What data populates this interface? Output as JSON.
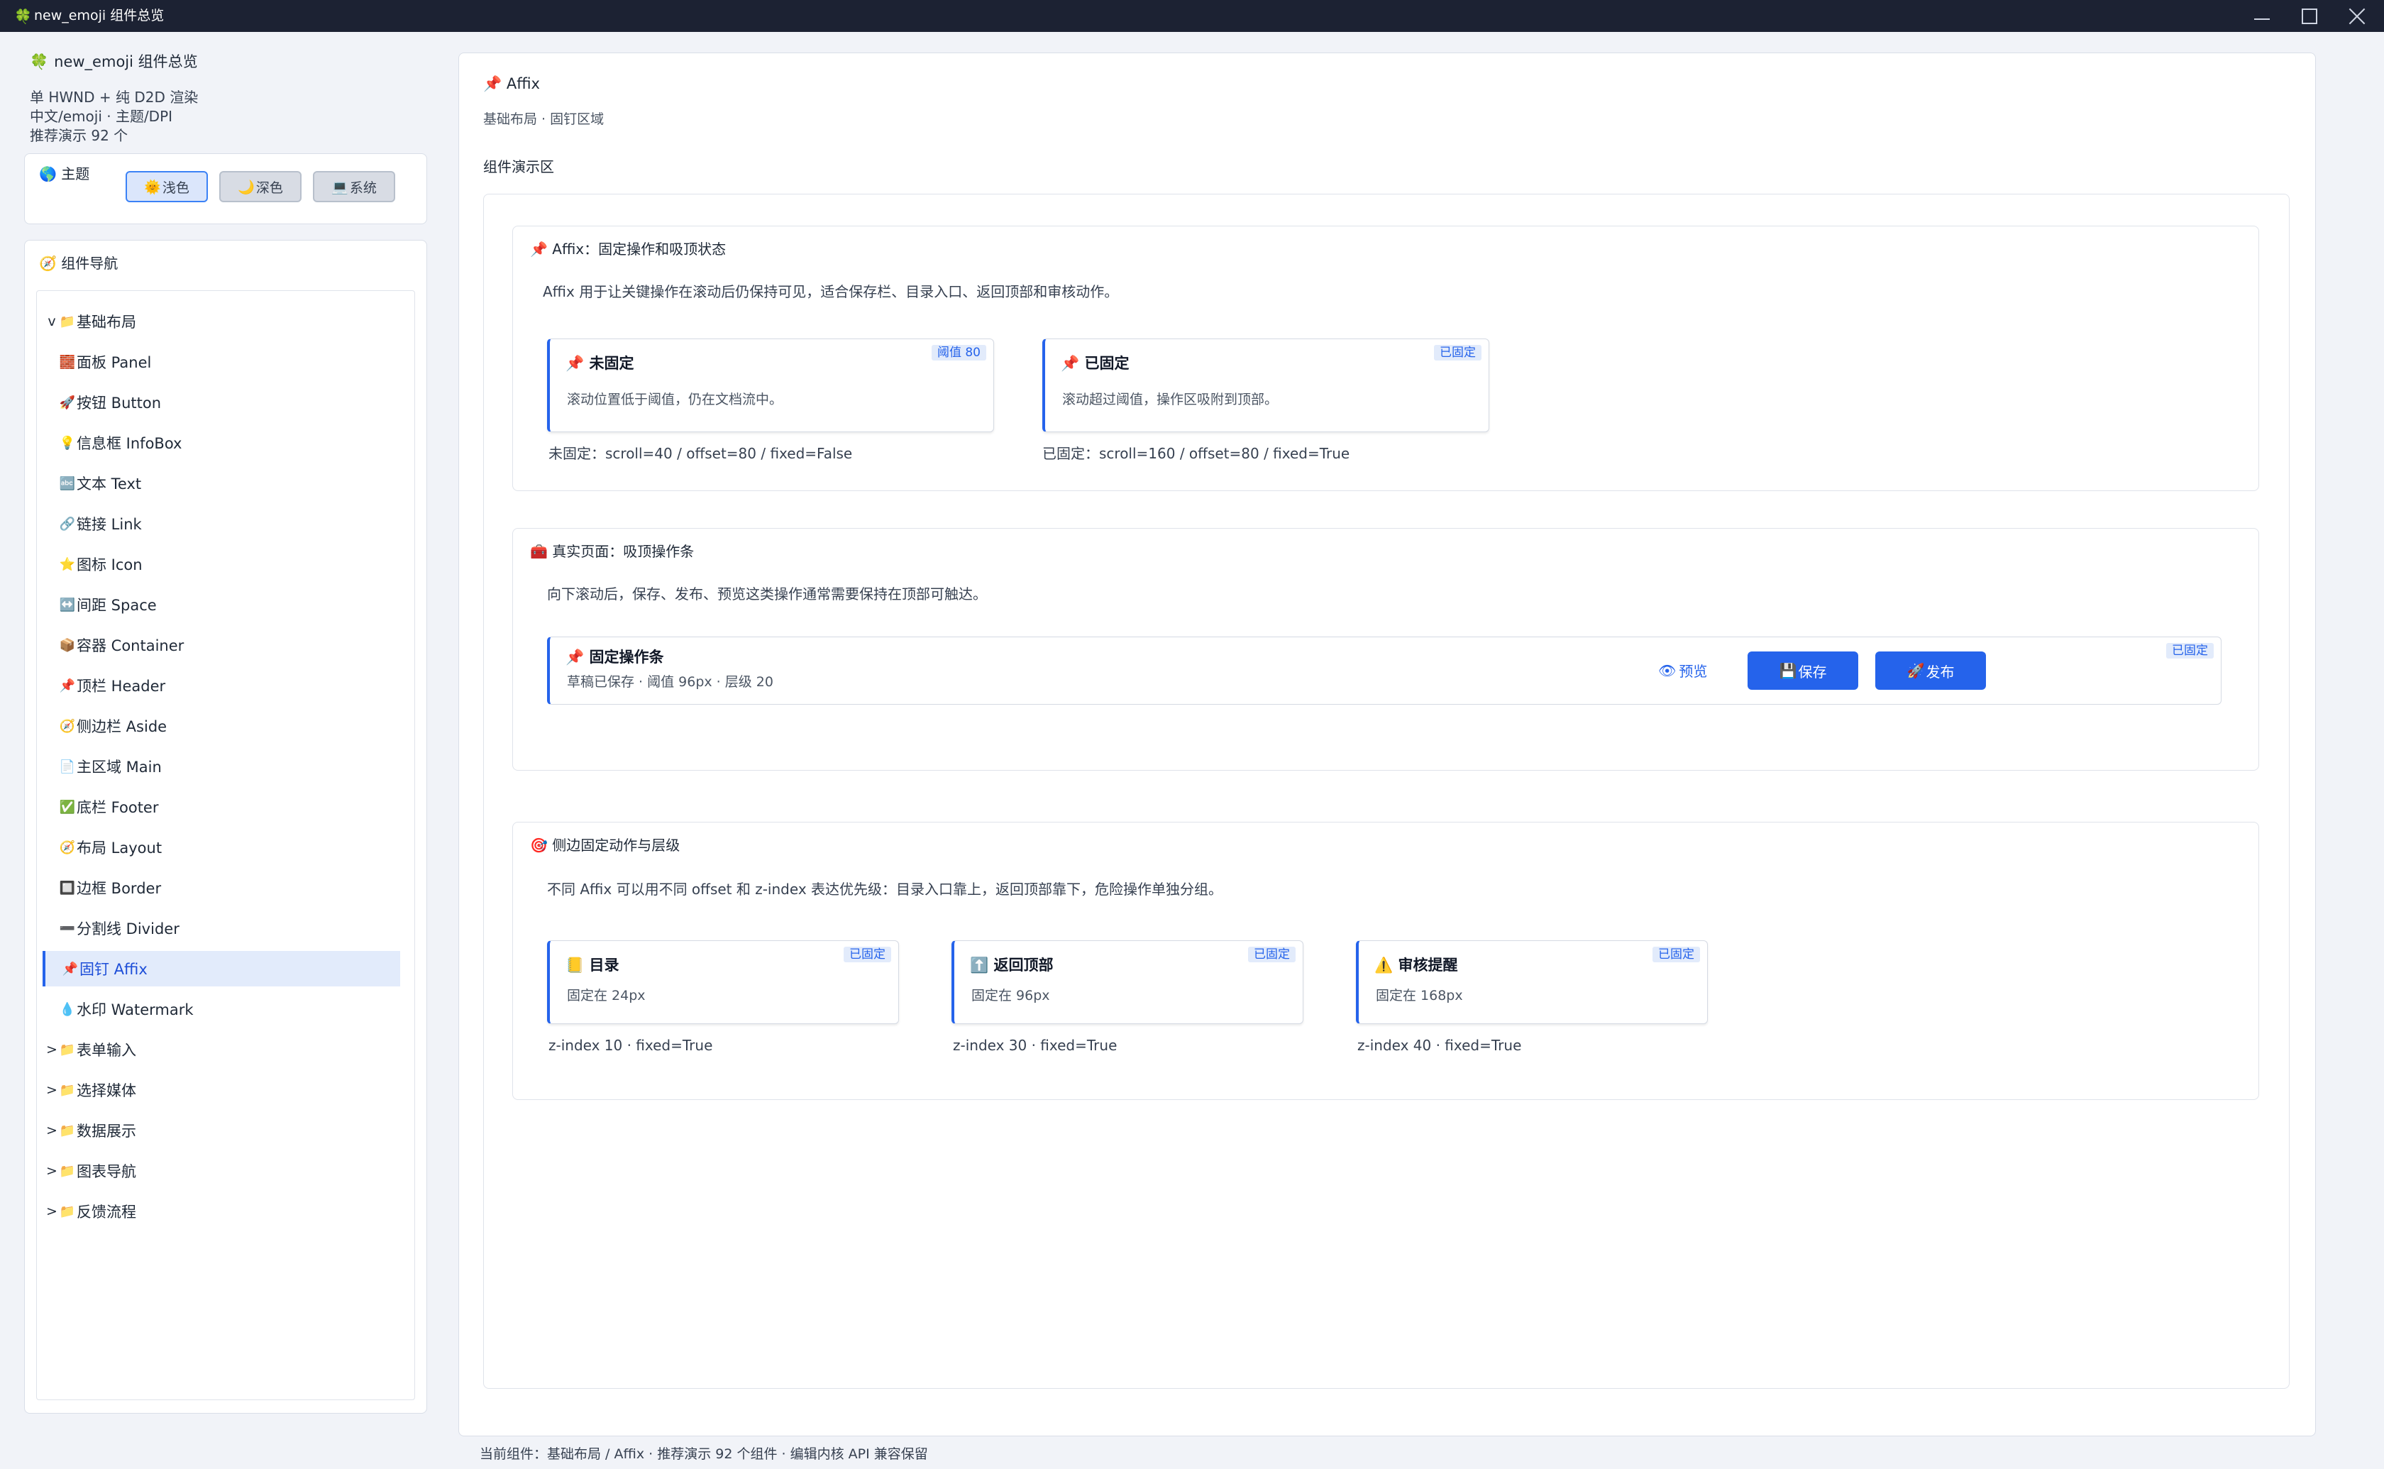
{
  "window": {
    "icon": "🍀",
    "title": "new_emoji 组件总览"
  },
  "sidebar": {
    "app_icon": "🍀",
    "app_title": "new_emoji 组件总览",
    "info_lines": [
      "单 HWND + 纯 D2D 渲染",
      "中文/emoji · 主题/DPI",
      "推荐演示 92 个"
    ],
    "theme": {
      "icon": "🌎",
      "label": "主题",
      "options": [
        {
          "icon": "🌞",
          "label": "浅色"
        },
        {
          "icon": "🌙",
          "label": "深色"
        },
        {
          "icon": "💻",
          "label": "系统"
        }
      ]
    },
    "nav": {
      "icon": "🧭",
      "label": "组件导航",
      "items": [
        {
          "caret": "v",
          "icon": "📁",
          "label": "基础布局"
        },
        {
          "icon": "🧱",
          "label": "面板 Panel"
        },
        {
          "icon": "🚀",
          "label": "按钮 Button"
        },
        {
          "icon": "💡",
          "label": "信息框 InfoBox"
        },
        {
          "icon": "🔤",
          "label": "文本 Text"
        },
        {
          "icon": "🔗",
          "label": "链接 Link"
        },
        {
          "icon": "⭐",
          "label": "图标 Icon"
        },
        {
          "icon": "↔️",
          "label": "间距 Space"
        },
        {
          "icon": "📦",
          "label": "容器 Container"
        },
        {
          "icon": "📌",
          "label": "顶栏 Header"
        },
        {
          "icon": "🧭",
          "label": "侧边栏 Aside"
        },
        {
          "icon": "📄",
          "label": "主区域 Main"
        },
        {
          "icon": "✅",
          "label": "底栏 Footer"
        },
        {
          "icon": "🧭",
          "label": "布局 Layout"
        },
        {
          "icon": "🔲",
          "label": "边框 Border"
        },
        {
          "icon": "➖",
          "label": "分割线 Divider"
        },
        {
          "icon": "📌",
          "label": "固钉 Affix"
        },
        {
          "icon": "💧",
          "label": "水印 Watermark"
        },
        {
          "caret": ">",
          "icon": "📁",
          "label": "表单输入"
        },
        {
          "caret": ">",
          "icon": "📁",
          "label": "选择媒体"
        },
        {
          "caret": ">",
          "icon": "📁",
          "label": "数据展示"
        },
        {
          "caret": ">",
          "icon": "📁",
          "label": "图表导航"
        },
        {
          "caret": ">",
          "icon": "📁",
          "label": "反馈流程"
        }
      ]
    }
  },
  "main": {
    "icon": "📌",
    "title": "Affix",
    "subtitle": "基础布局 · 固钉区域",
    "demo_label": "组件演示区",
    "section1": {
      "icon": "📌",
      "title": "Affix：固定操作和吸顶状态",
      "desc": "Affix 用于让关键操作在滚动后仍保持可见，适合保存栏、目录入口、返回顶部和审核动作。",
      "cards": [
        {
          "icon": "📌",
          "title": "未固定",
          "desc": "滚动位置低于阈值，仍在文档流中。",
          "badge": "阈值 80",
          "status": "未固定：scroll=40 / offset=80 / fixed=False"
        },
        {
          "icon": "📌",
          "title": "已固定",
          "desc": "滚动超过阈值，操作区吸附到顶部。",
          "badge": "已固定",
          "status": "已固定：scroll=160 / offset=80 / fixed=True"
        }
      ]
    },
    "section2": {
      "icon": "🧰",
      "title": "真实页面：吸顶操作条",
      "desc": "向下滚动后，保存、发布、预览这类操作通常需要保持在顶部可触达。",
      "bar": {
        "icon": "📌",
        "title": "固定操作条",
        "desc": "草稿已保存 · 阈值 96px · 层级 20",
        "badge": "已固定",
        "preview": {
          "icon": "👁",
          "label": "预览"
        },
        "save": {
          "icon": "💾",
          "label": "保存"
        },
        "publish": {
          "icon": "🚀",
          "label": "发布"
        }
      }
    },
    "section3": {
      "icon": "🎯",
      "title": "侧边固定动作与层级",
      "desc": "不同 Affix 可以用不同 offset 和 z-index 表达优先级：目录入口靠上，返回顶部靠下，危险操作单独分组。",
      "cards": [
        {
          "icon": "📒",
          "title": "目录",
          "desc": "固定在 24px",
          "badge": "已固定",
          "status": "z-index 10 · fixed=True"
        },
        {
          "icon": "⬆️",
          "title": "返回顶部",
          "desc": "固定在 96px",
          "badge": "已固定",
          "status": "z-index 30 · fixed=True"
        },
        {
          "icon": "⚠️",
          "title": "审核提醒",
          "desc": "固定在 168px",
          "badge": "已固定",
          "status": "z-index 40 · fixed=True"
        }
      ]
    }
  },
  "footer": {
    "text": "当前组件：基础布局 / Affix · 推荐演示 92 个组件 · 编辑内核 API 兼容保留"
  }
}
